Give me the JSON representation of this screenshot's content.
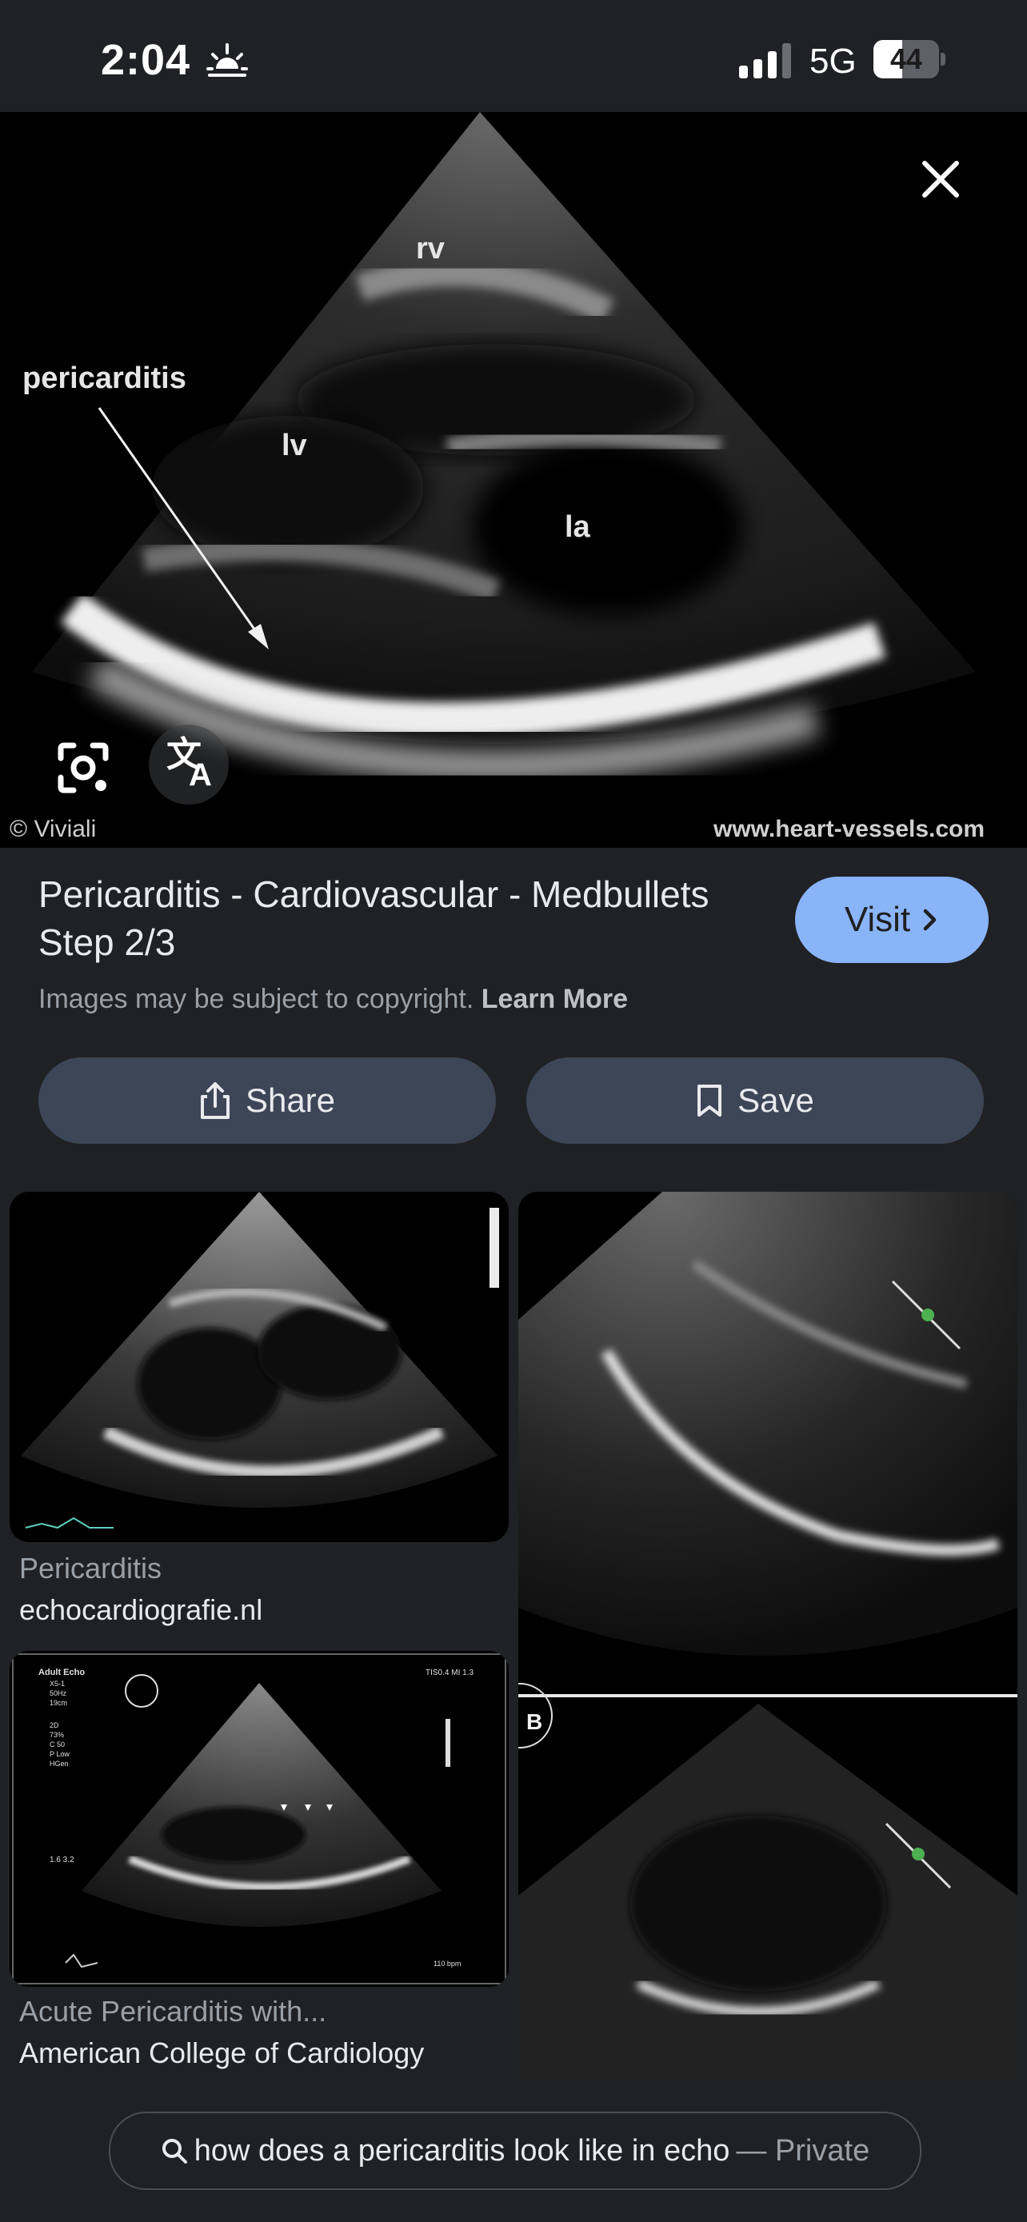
{
  "status_bar": {
    "time": "2:04",
    "network": "5G",
    "battery_level": "44",
    "battery_fraction": 0.44
  },
  "hero": {
    "labels": {
      "rv": "rv",
      "lv": "lv",
      "la": "la",
      "pericarditis": "pericarditis"
    },
    "credit_left": "© Viviali",
    "credit_right": "www.heart-vessels.com"
  },
  "result": {
    "title": "Pericarditis - Cardiovascular - Medbullets Step 2/3",
    "visit_label": "Visit",
    "copyright_note": "Images may be subject to copyright.",
    "learn_more": "Learn More",
    "share_label": "Share",
    "save_label": "Save"
  },
  "related": [
    {
      "title": "Pericarditis",
      "source": "echocardiografie.nl"
    },
    {
      "title": "",
      "source": ""
    },
    {
      "title": "Acute Pericarditis with...",
      "source": "American College of Cardiology"
    }
  ],
  "thumb_3_overlay": {
    "header": [
      "Adult Echo",
      "X5-1",
      "50Hz",
      "19cm"
    ],
    "top_right": "TIS0.4  MI 1.3",
    "settings": [
      "2D",
      "73%",
      "C 50",
      "P Low",
      "HGen"
    ],
    "values": "1.6  3.2",
    "bpm": "110 bpm"
  },
  "thumb_2_overlay": {
    "panel_b": "B"
  },
  "search": {
    "query": "how does a pericarditis look like in echo",
    "private_label": "— Private"
  },
  "colors": {
    "background": "#202124",
    "visit_button": "#8ab4f8",
    "action_button": "#3c4657"
  },
  "icons": [
    "sunrise-icon",
    "signal-icon",
    "battery-icon",
    "close-icon",
    "lens-icon",
    "translate-icon",
    "chevron-right-icon",
    "share-icon",
    "bookmark-icon",
    "search-icon"
  ]
}
